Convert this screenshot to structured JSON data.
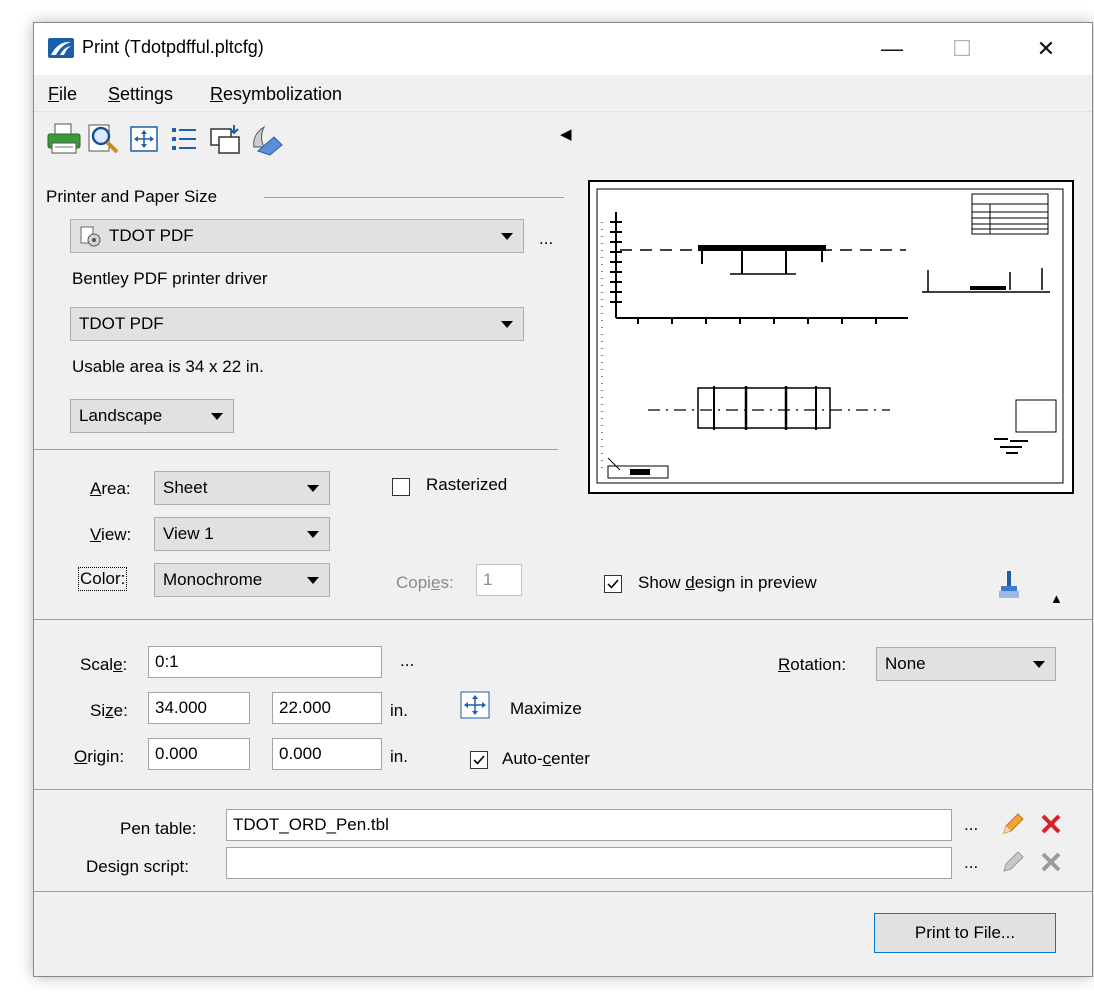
{
  "window": {
    "title": "Print  (Tdotpdfful.pltcfg)",
    "minimize_glyph": "—",
    "maximize_glyph": "☐",
    "close_glyph": "✕"
  },
  "menu": {
    "file_u": "F",
    "file_rest": "ile",
    "settings_u": "S",
    "settings_rest": "ettings",
    "resym_u": "R",
    "resym_rest": "esymbolization"
  },
  "toolbar": {
    "icons": [
      "printer-icon",
      "preview-magnifier-icon",
      "maximize-area-icon",
      "list-icon",
      "copy-to-window-icon",
      "eraser-icon"
    ],
    "collapse_glyph": "◀"
  },
  "printer": {
    "section_label": "Printer and Paper Size",
    "printer_name": "TDOT PDF",
    "more_button": "...",
    "driver": "Bentley PDF printer driver",
    "paper_size": "TDOT PDF",
    "usable_area": "Usable area is 34 x 22 in.",
    "orientation": "Landscape"
  },
  "area": {
    "area_label_u": "A",
    "area_label_rest": "rea:",
    "area_value": "Sheet",
    "view_label_u": "V",
    "view_label_rest": "iew:",
    "view_value": "View 1",
    "color_label": "Color:",
    "color_value": "Monochrome",
    "rasterized_label": "Rasterized",
    "rasterized_checked": false,
    "copies_label_pre": "Copi",
    "copies_label_u": "e",
    "copies_label_post": "s:",
    "copies_value": "1",
    "show_design_pre": "Show ",
    "show_design_u": "d",
    "show_design_post": "esign in preview",
    "show_design_checked": true
  },
  "scale": {
    "scale_label_pre": "Scal",
    "scale_label_u": "e",
    "scale_label_post": ":",
    "scale_value": "0:1",
    "scale_more": "...",
    "rotation_label_u": "R",
    "rotation_label_rest": "otation:",
    "rotation_value": "None",
    "size_label_pre": "Si",
    "size_label_u": "z",
    "size_label_post": "e:",
    "size_w": "34.000",
    "size_h": "22.000",
    "size_unit": "in.",
    "maximize_label": "Maximize",
    "origin_label_u": "O",
    "origin_label_rest": "rigin:",
    "origin_x": "0.000",
    "origin_y": "0.000",
    "origin_unit": "in.",
    "autocenter_pre": "Auto-",
    "autocenter_u": "c",
    "autocenter_post": "enter",
    "autocenter_checked": true
  },
  "pen": {
    "pen_table_label": "Pen table:",
    "pen_table_value": "TDOT_ORD_Pen.tbl",
    "design_script_label": "Design script:",
    "design_script_value": "",
    "more": "..."
  },
  "actions": {
    "print_button": "Print to File..."
  },
  "colors": {
    "accent": "#0078d7",
    "edit_pencil": "#f2a23a",
    "delete_red": "#d9202a",
    "disabled_gray": "#9a9a9a"
  }
}
